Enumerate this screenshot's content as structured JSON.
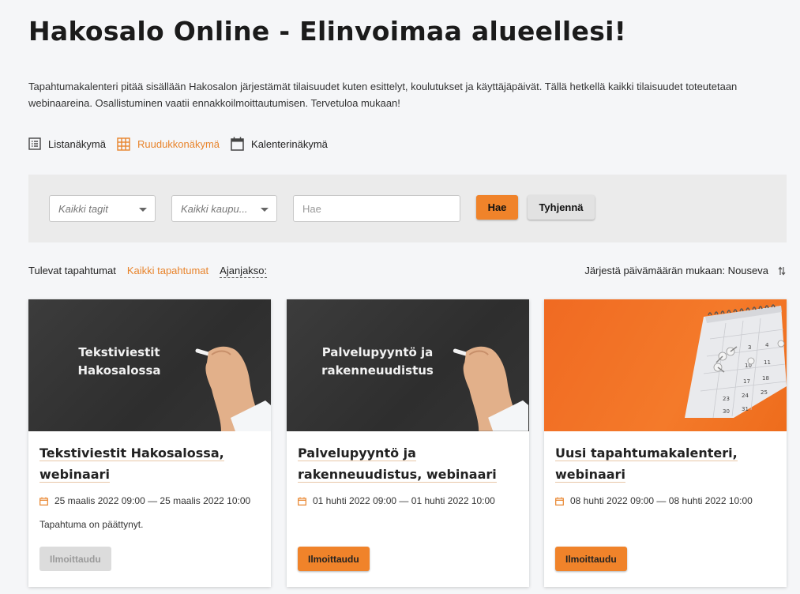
{
  "page": {
    "title": "Hakosalo Online - Elinvoimaa alueellesi!",
    "intro": "Tapahtumakalenteri pitää sisällään Hakosalon järjestämät tilaisuudet kuten esittelyt, koulutukset ja käyttäjäpäivät. Tällä hetkellä kaikki tilaisuudet toteutetaan webinaareina. Osallistuminen vaatii ennakkoilmoittautumisen. Tervetuloa mukaan!"
  },
  "views": [
    {
      "label": "Listanäkymä",
      "icon": "list-icon",
      "active": false
    },
    {
      "label": "Ruudukkonäkymä",
      "icon": "grid-icon",
      "active": true
    },
    {
      "label": "Kalenterinäkymä",
      "icon": "calendar-icon",
      "active": false
    }
  ],
  "filters": {
    "tags_value": "Kaikki tagit",
    "city_value": "Kaikki kaupu...",
    "search_placeholder": "Hae",
    "search_button": "Hae",
    "clear_button": "Tyhjennä"
  },
  "timeline": {
    "upcoming": "Tulevat tapahtumat",
    "all": "Kaikki tapahtumat",
    "period": "Ajanjakso:",
    "sort": "Järjestä päivämäärän mukaan: Nouseva"
  },
  "events": [
    {
      "image_text_line1": "Tekstiviestit",
      "image_text_line2": "Hakosalossa",
      "title": "Tekstiviestit Hakosalossa, webinaari",
      "date": "25 maalis 2022 09:00 — 25 maalis 2022 10:00",
      "status": "Tapahtuma on päättynyt.",
      "button": "Ilmoittaudu",
      "button_enabled": false
    },
    {
      "image_text_line1": "Palvelupyyntö ja",
      "image_text_line2": "rakenneuudistus",
      "title": "Palvelupyyntö ja rakenneuudistus, webinaari",
      "date": "01 huhti 2022 09:00 — 01 huhti 2022 10:00",
      "status": "",
      "button": "Ilmoittaudu",
      "button_enabled": true
    },
    {
      "title": "Uusi tapahtumakalenteri, webinaari",
      "date": "08 huhti 2022 09:00 — 08 huhti 2022 10:00",
      "status": "",
      "button": "Ilmoittaudu",
      "button_enabled": true,
      "calendar_numbers": [
        "3",
        "4",
        "10",
        "11",
        "17",
        "18",
        "23",
        "24",
        "25",
        "30",
        "31"
      ]
    }
  ],
  "colors": {
    "accent": "#f0832a",
    "background": "#f5f6f8"
  }
}
